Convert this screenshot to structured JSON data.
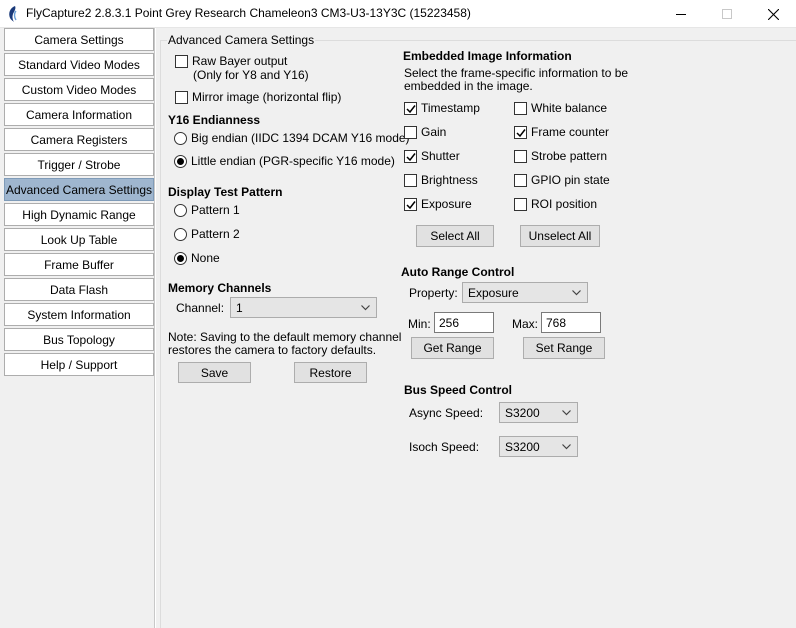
{
  "window": {
    "title": "FlyCapture2 2.8.3.1  Point Grey Research Chameleon3 CM3-U3-13Y3C (15223458)"
  },
  "sidebar": {
    "items": [
      {
        "label": "Camera Settings"
      },
      {
        "label": "Standard Video Modes"
      },
      {
        "label": "Custom Video Modes"
      },
      {
        "label": "Camera Information"
      },
      {
        "label": "Camera Registers"
      },
      {
        "label": "Trigger / Strobe"
      },
      {
        "label": "Advanced Camera Settings"
      },
      {
        "label": "High Dynamic Range"
      },
      {
        "label": "Look Up Table"
      },
      {
        "label": "Frame Buffer"
      },
      {
        "label": "Data Flash"
      },
      {
        "label": "System Information"
      },
      {
        "label": "Bus Topology"
      },
      {
        "label": "Help / Support"
      }
    ],
    "active_label": "Advanced Camera Settings"
  },
  "panel": {
    "group_title": "Advanced Camera Settings",
    "raw_bayer": {
      "label_line1": "Raw Bayer output",
      "label_line2": "(Only for Y8 and Y16)",
      "checked": false
    },
    "mirror": {
      "label": "Mirror image (horizontal flip)",
      "checked": false
    },
    "endianness": {
      "heading": "Y16 Endianness",
      "options": [
        "Big endian (IIDC 1394 DCAM Y16 mode)",
        "Little endian (PGR-specific Y16 mode)"
      ],
      "selected": "Little endian (PGR-specific Y16 mode)"
    },
    "test_pattern": {
      "heading": "Display Test Pattern",
      "options": [
        "Pattern 1",
        "Pattern 2",
        "None"
      ],
      "selected": "None"
    },
    "memory": {
      "heading": "Memory Channels",
      "channel_label": "Channel:",
      "channel_value": "1",
      "note_line1": "Note: Saving to the default memory channel",
      "note_line2": "restores the camera to factory defaults.",
      "save_label": "Save",
      "restore_label": "Restore"
    },
    "embedded": {
      "heading": "Embedded Image Information",
      "desc_line1": "Select the frame-specific information to be",
      "desc_line2": "embedded in the image.",
      "items": [
        {
          "label": "Timestamp",
          "checked": true
        },
        {
          "label": "Gain",
          "checked": false
        },
        {
          "label": "Shutter",
          "checked": true
        },
        {
          "label": "Brightness",
          "checked": false
        },
        {
          "label": "Exposure",
          "checked": true
        },
        {
          "label": "White balance",
          "checked": false
        },
        {
          "label": "Frame counter",
          "checked": true
        },
        {
          "label": "Strobe pattern",
          "checked": false
        },
        {
          "label": "GPIO pin state",
          "checked": false
        },
        {
          "label": "ROI position",
          "checked": false
        }
      ],
      "select_all_label": "Select All",
      "unselect_all_label": "Unselect All"
    },
    "auto_range": {
      "heading": "Auto Range Control",
      "property_label": "Property:",
      "property_value": "Exposure",
      "min_label": "Min:",
      "min_value": "256",
      "max_label": "Max:",
      "max_value": "768",
      "get_range_label": "Get Range",
      "set_range_label": "Set Range"
    },
    "bus_speed": {
      "heading": "Bus Speed Control",
      "async_label": "Async Speed:",
      "async_value": "S3200",
      "isoch_label": "Isoch Speed:",
      "isoch_value": "S3200"
    }
  }
}
